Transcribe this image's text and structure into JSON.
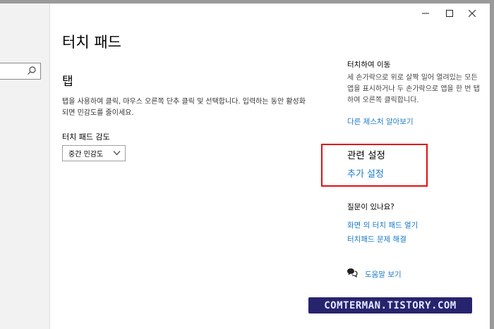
{
  "window": {
    "minimize": "minimize",
    "maximize": "maximize",
    "close": "close"
  },
  "page": {
    "title": "터치 패드"
  },
  "tap_section": {
    "title": "탭",
    "description": "탭을 사용하여 클릭, 마우스 오른쪽 단추 클릭 및 선택합니다. 입력하는 동안 활성화되면 민감도를 줄이세요.",
    "sensitivity_label": "터치 패드 감도",
    "sensitivity_value": "중간 민감도"
  },
  "tip": {
    "title": "터치하여 이동",
    "body": "세 손가락으로 위로 살짝 밀어 열려있는 모든 앱을 표시하거나 두 손가락으로 앱을 한 번 탭하여 오른쪽 클릭합니다.",
    "link": "다른 제스처 알아보기"
  },
  "related": {
    "title": "관련 설정",
    "link": "추가 설정"
  },
  "questions": {
    "title": "질문이 있나요?",
    "link1": "화면 의 터치 패드 열기",
    "link2": "터치패드 문제 해결"
  },
  "help": {
    "link": "도움말 보기"
  },
  "watermark": {
    "text": "COMTERMAN.TISTORY.COM"
  },
  "colors": {
    "link": "#1a7ac8",
    "highlight_border": "#e01010",
    "watermark_bg": "#27246e"
  }
}
